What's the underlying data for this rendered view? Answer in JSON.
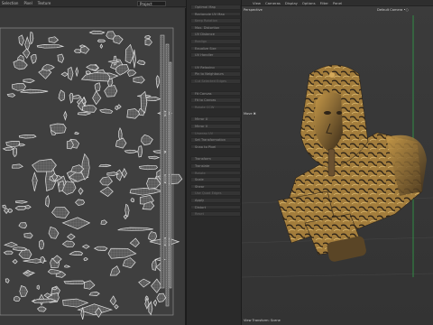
{
  "uv_editor": {
    "menu": [
      "Selection",
      "Pixel",
      "Texture"
    ],
    "projection_select": "Project"
  },
  "tool_panel": {
    "items": [
      "Optimal Map",
      "Rectangle UV Map",
      "Keep Rotation",
      "Max. Distortion",
      "UV Distance",
      "Realign",
      "Equalize Size",
      "UV Handler",
      "UV Relaxing",
      "Pin to Neighbours",
      "Cut Selected Edges",
      "Fit Canvas",
      "Fit to Canvas",
      "Rotate CCW",
      "Mirror U",
      "Mirror V",
      "Unwrap UV",
      "Set Transformation",
      "Snap to Pixel",
      "Transform",
      "Translate",
      "Rotate",
      "Scale",
      "Shear",
      "Use Quad Edges",
      "Apply",
      "Distort",
      "Reset"
    ]
  },
  "viewport": {
    "menu": [
      "View",
      "Cameras",
      "Display",
      "Options",
      "Filter",
      "Panel"
    ],
    "mode_label": "Perspective",
    "camera_label": "Default Camera •○",
    "move_label": "Move ✖",
    "footer_label": "View Transform: Scene"
  },
  "colors": {
    "background": "#2b2b2b",
    "uv_wire": "#d7d7d7",
    "uv_fill": "#555555",
    "sphinx_gold": "#b8893b",
    "sphinx_dark": "#2e2418",
    "y_axis": "#2fa24a"
  }
}
